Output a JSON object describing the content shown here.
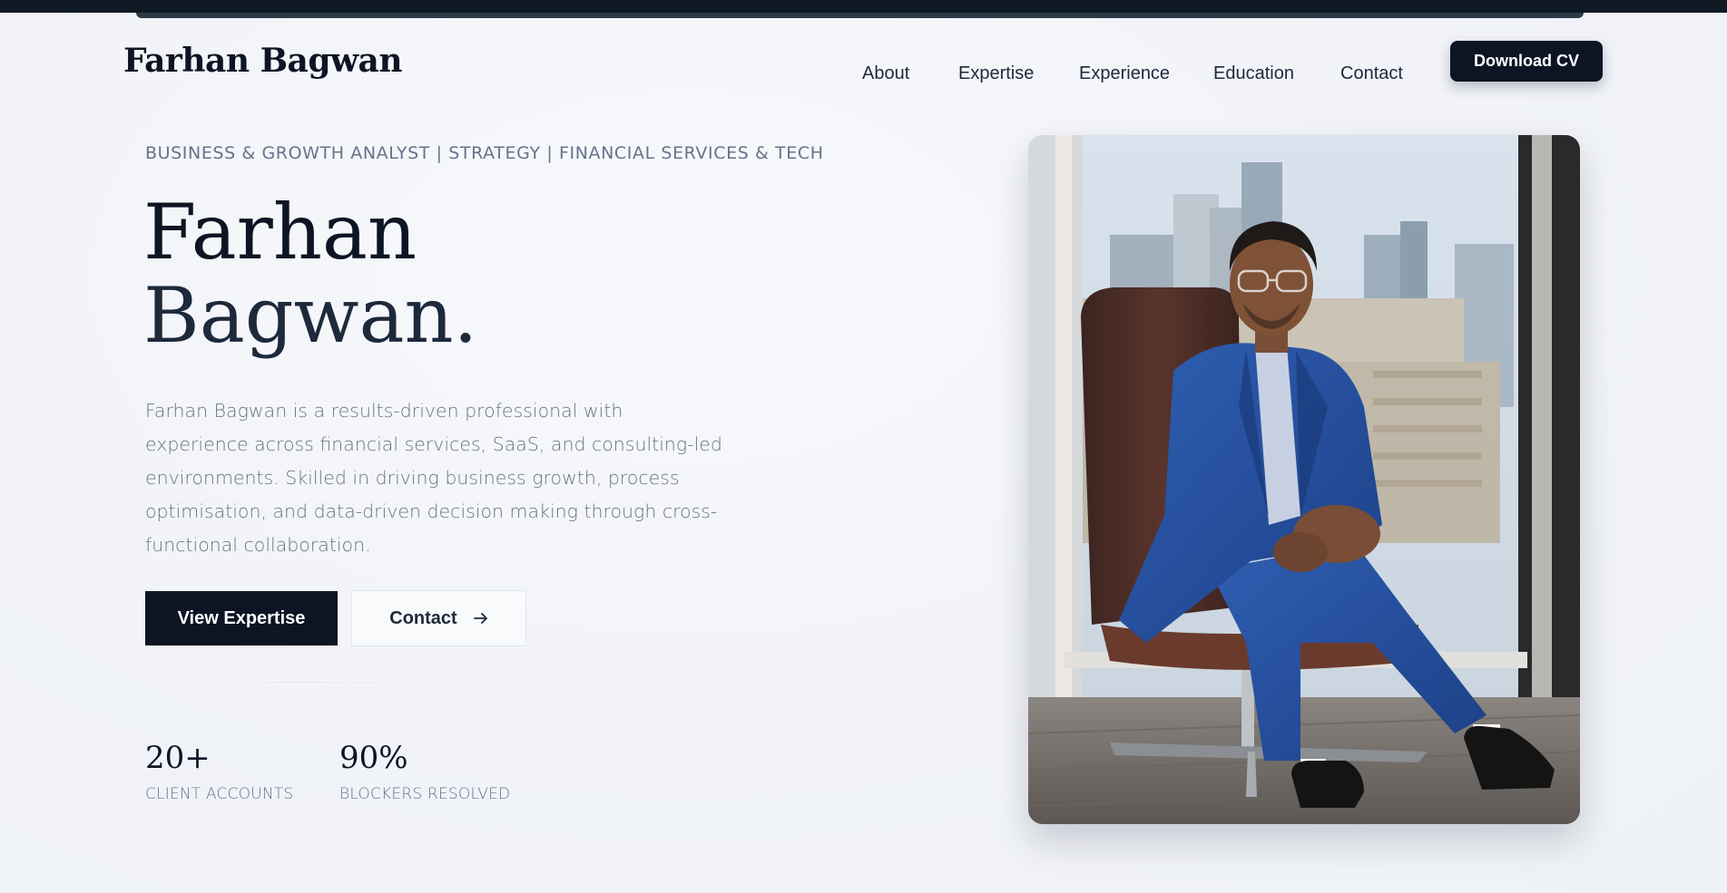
{
  "header": {
    "brand": "Farhan Bagwan",
    "nav": [
      {
        "label": "About"
      },
      {
        "label": "Expertise"
      },
      {
        "label": "Experience"
      },
      {
        "label": "Education"
      },
      {
        "label": "Contact"
      }
    ],
    "cta_label": "Download CV"
  },
  "hero": {
    "kicker": "BUSINESS & GROWTH ANALYST | STRATEGY | FINANCIAL SERVICES & TECH",
    "title_line1": "Farhan",
    "title_line2": "Bagwan.",
    "description": "Farhan Bagwan is a results-driven professional with experience across financial services, SaaS, and consulting-led environments. Skilled in driving business growth, process optimisation, and data-driven decision making through cross-functional collaboration.",
    "primary_button": "View Expertise",
    "secondary_button": "Contact",
    "secondary_icon": "arrow-right-icon"
  },
  "stats": [
    {
      "value": "20+",
      "label": "CLIENT ACCOUNTS"
    },
    {
      "value": "90%",
      "label": "BLOCKERS RESOLVED"
    }
  ],
  "photo": {
    "icon": "portrait-photo"
  },
  "colors": {
    "navy": "#0d1424",
    "muted": "#64748b",
    "suit_blue": "#2a56a8"
  }
}
